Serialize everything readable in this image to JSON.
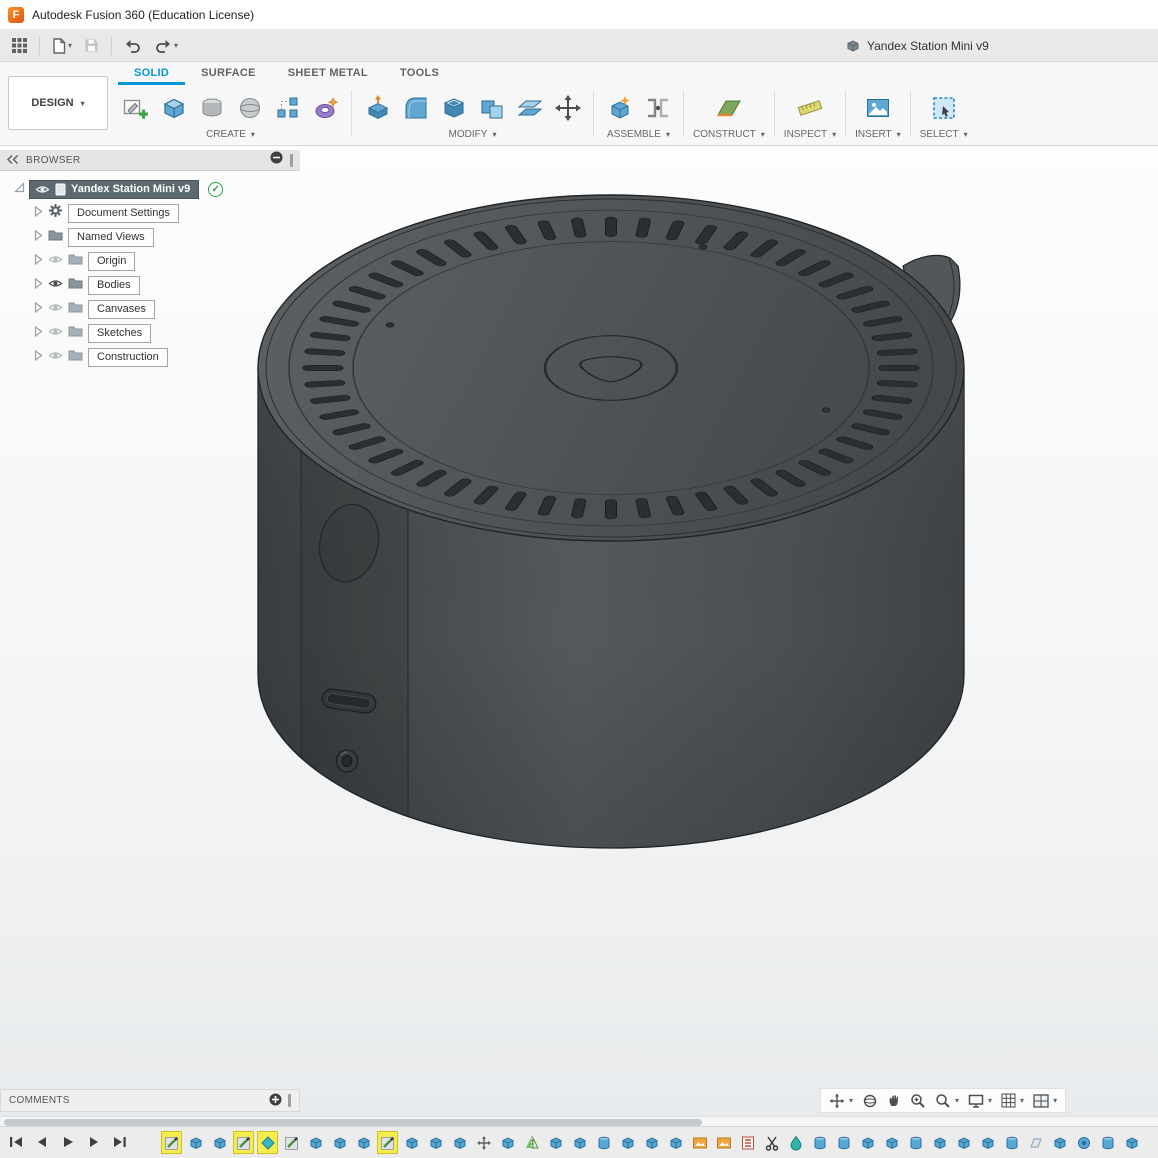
{
  "app": {
    "title": "Autodesk Fusion 360 (Education License)",
    "document_title": "Yandex Station Mini v9"
  },
  "workspace": {
    "label": "DESIGN"
  },
  "tabs": [
    {
      "label": "SOLID",
      "active": true
    },
    {
      "label": "SURFACE",
      "active": false
    },
    {
      "label": "SHEET METAL",
      "active": false
    },
    {
      "label": "TOOLS",
      "active": false
    }
  ],
  "groups": [
    {
      "label": "CREATE"
    },
    {
      "label": "MODIFY"
    },
    {
      "label": "ASSEMBLE"
    },
    {
      "label": "CONSTRUCT"
    },
    {
      "label": "INSPECT"
    },
    {
      "label": "INSERT"
    },
    {
      "label": "SELECT"
    }
  ],
  "browser": {
    "header": "BROWSER",
    "root": {
      "label": "Yandex Station Mini v9",
      "selected": true
    },
    "items": [
      {
        "label": "Document Settings",
        "icon": "gear",
        "eye": "none"
      },
      {
        "label": "Named Views",
        "icon": "folder",
        "eye": "none"
      },
      {
        "label": "Origin",
        "icon": "folder",
        "eye": "off"
      },
      {
        "label": "Bodies",
        "icon": "folder",
        "eye": "on"
      },
      {
        "label": "Canvases",
        "icon": "folder",
        "eye": "off"
      },
      {
        "label": "Sketches",
        "icon": "folder",
        "eye": "off"
      },
      {
        "label": "Construction",
        "icon": "folder",
        "eye": "off"
      }
    ]
  },
  "comments": {
    "label": "COMMENTS"
  },
  "timeline": {
    "icons": [
      {
        "type": "sketch",
        "highlighted": true
      },
      {
        "type": "extrude",
        "highlighted": false
      },
      {
        "type": "extrude",
        "highlighted": false
      },
      {
        "type": "sketch",
        "highlighted": true
      },
      {
        "type": "primitive",
        "highlighted": true
      },
      {
        "type": "sketch",
        "highlighted": false
      },
      {
        "type": "extrude",
        "highlighted": false
      },
      {
        "type": "extrude",
        "highlighted": false
      },
      {
        "type": "extrude",
        "highlighted": false
      },
      {
        "type": "sketch",
        "highlighted": true
      },
      {
        "type": "extrude",
        "highlighted": false
      },
      {
        "type": "extrude",
        "highlighted": false
      },
      {
        "type": "extrude",
        "highlighted": false
      },
      {
        "type": "move",
        "highlighted": false
      },
      {
        "type": "extrude",
        "highlighted": false
      },
      {
        "type": "mirror",
        "highlighted": false
      },
      {
        "type": "extrude",
        "highlighted": false
      },
      {
        "type": "extrude",
        "highlighted": false
      },
      {
        "type": "revolve",
        "highlighted": false
      },
      {
        "type": "extrude",
        "highlighted": false
      },
      {
        "type": "extrude",
        "highlighted": false
      },
      {
        "type": "extrude",
        "highlighted": false
      },
      {
        "type": "canvas",
        "highlighted": false
      },
      {
        "type": "canvas",
        "highlighted": false
      },
      {
        "type": "decal",
        "highlighted": false
      },
      {
        "type": "split",
        "highlighted": false
      },
      {
        "type": "fluid",
        "highlighted": false
      },
      {
        "type": "revolve",
        "highlighted": false
      },
      {
        "type": "revolve",
        "highlighted": false
      },
      {
        "type": "extrude",
        "highlighted": false
      },
      {
        "type": "extrude",
        "highlighted": false
      },
      {
        "type": "revolve",
        "highlighted": false
      },
      {
        "type": "extrude",
        "highlighted": false
      },
      {
        "type": "extrude",
        "highlighted": false
      },
      {
        "type": "extrude",
        "highlighted": false
      },
      {
        "type": "revolve",
        "highlighted": false
      },
      {
        "type": "plane",
        "highlighted": false
      },
      {
        "type": "extrude",
        "highlighted": false
      },
      {
        "type": "hole",
        "highlighted": false
      },
      {
        "type": "revolve",
        "highlighted": false
      },
      {
        "type": "extrude",
        "highlighted": false
      }
    ]
  },
  "colors": {
    "accent": "#0696d7",
    "timeline_highlight": "#f5ec4e",
    "selected_node": "#5d6970",
    "model_body": "#4a4e50"
  }
}
